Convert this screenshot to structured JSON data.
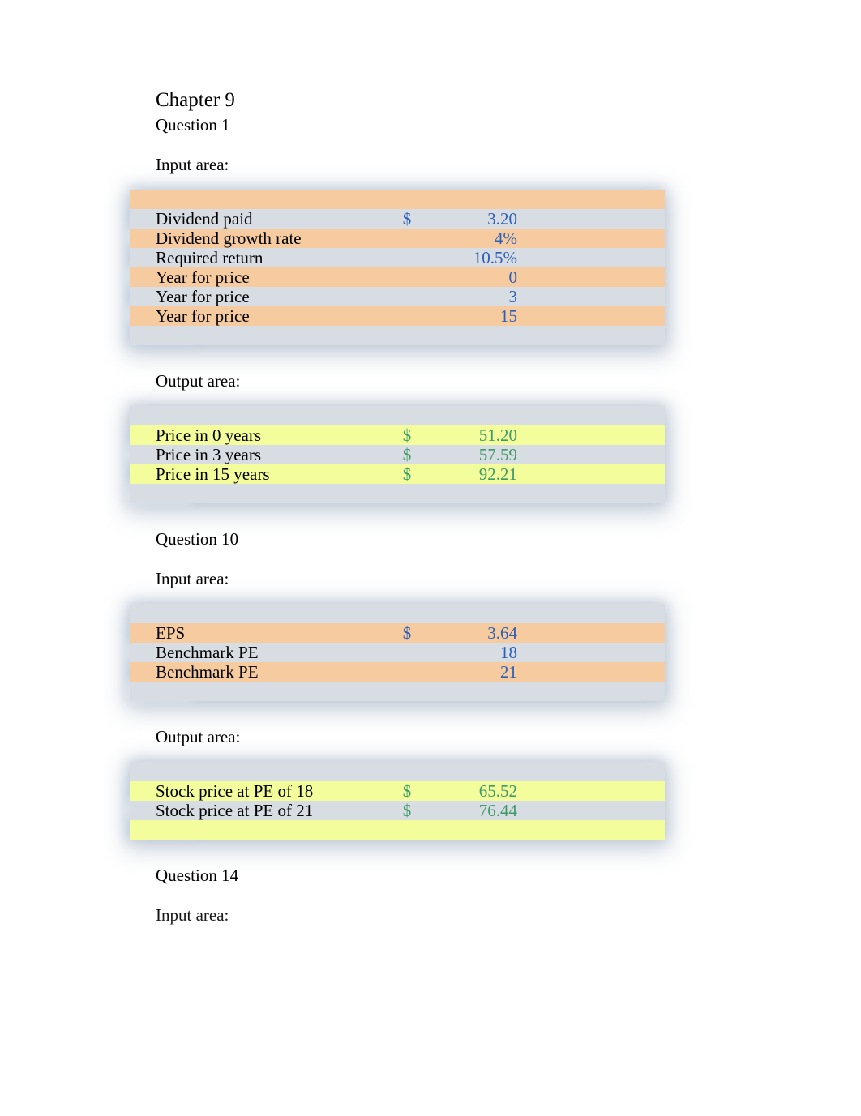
{
  "chapter_title": "Chapter 9",
  "q1": {
    "label": "Question 1",
    "input_label": "Input area:",
    "output_label": "Output area:",
    "inputs": [
      {
        "label": "Dividend paid",
        "currency": "$",
        "value": "3.20"
      },
      {
        "label": "Dividend growth rate",
        "currency": "",
        "value": "4%"
      },
      {
        "label": "Required return",
        "currency": "",
        "value": "10.5%"
      },
      {
        "label": "Year for price",
        "currency": "",
        "value": "0"
      },
      {
        "label": "Year for price",
        "currency": "",
        "value": "3"
      },
      {
        "label": "Year for price",
        "currency": "",
        "value": "15"
      }
    ],
    "outputs": [
      {
        "label": "Price in 0 years",
        "currency": "$",
        "value": "51.20"
      },
      {
        "label": "Price in 3 years",
        "currency": "$",
        "value": "57.59"
      },
      {
        "label": "Price in 15 years",
        "currency": "$",
        "value": "92.21"
      }
    ]
  },
  "q10": {
    "label": "Question 10",
    "input_label": "Input area:",
    "output_label": "Output area:",
    "inputs": [
      {
        "label": "EPS",
        "currency": "$",
        "value": "3.64"
      },
      {
        "label": "Benchmark PE",
        "currency": "",
        "value": "18"
      },
      {
        "label": "Benchmark PE",
        "currency": "",
        "value": "21"
      }
    ],
    "outputs": [
      {
        "label": "Stock price at PE of 18",
        "currency": "$",
        "value": "65.52"
      },
      {
        "label": "Stock price at PE of 21",
        "currency": "$",
        "value": "76.44"
      }
    ]
  },
  "q14": {
    "label": "Question 14",
    "input_label": "Input area:"
  }
}
